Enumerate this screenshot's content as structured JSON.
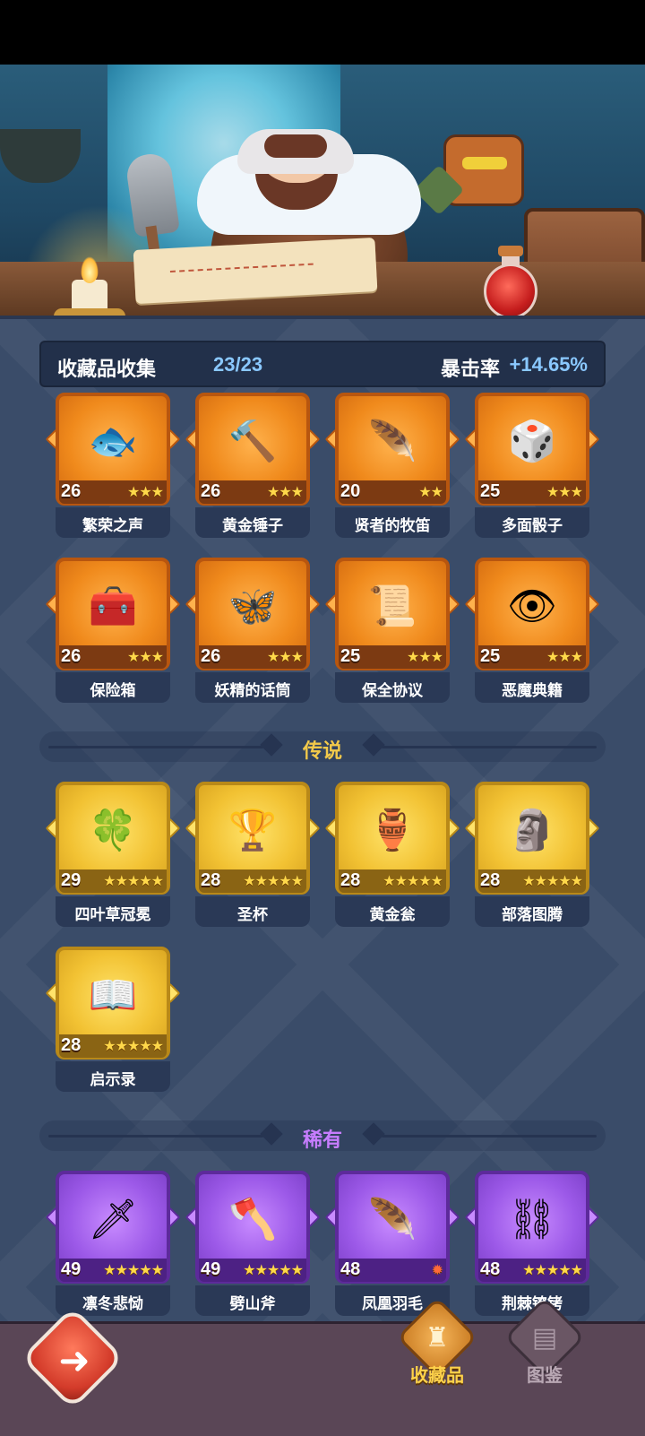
{
  "collection": {
    "label": "收藏品收集",
    "count": "23/23",
    "crit_label": "暴击率",
    "crit_value": "+14.65%"
  },
  "sections": {
    "legend": "传说",
    "rare": "稀有"
  },
  "epic_items": [
    {
      "name": "繁荣之声",
      "level": "26",
      "stars": "★★★",
      "icon": "🐟"
    },
    {
      "name": "黄金锤子",
      "level": "26",
      "stars": "★★★",
      "icon": "🔨"
    },
    {
      "name": "贤者的牧笛",
      "level": "20",
      "stars": "★★",
      "icon": "🪶"
    },
    {
      "name": "多面骰子",
      "level": "25",
      "stars": "★★★",
      "icon": "🎲"
    },
    {
      "name": "保险箱",
      "level": "26",
      "stars": "★★★",
      "icon": "🧰"
    },
    {
      "name": "妖精的话筒",
      "level": "26",
      "stars": "★★★",
      "icon": "🦋"
    },
    {
      "name": "保全协议",
      "level": "25",
      "stars": "★★★",
      "icon": "📜"
    },
    {
      "name": "恶魔典籍",
      "level": "25",
      "stars": "★★★",
      "icon": "👁"
    }
  ],
  "legend_items": [
    {
      "name": "四叶草冠冕",
      "level": "29",
      "stars": "★★★★★",
      "icon": "🍀"
    },
    {
      "name": "圣杯",
      "level": "28",
      "stars": "★★★★★",
      "icon": "🏆"
    },
    {
      "name": "黄金瓮",
      "level": "28",
      "stars": "★★★★★",
      "icon": "🏺"
    },
    {
      "name": "部落图腾",
      "level": "28",
      "stars": "★★★★★",
      "icon": "🗿"
    },
    {
      "name": "启示录",
      "level": "28",
      "stars": "★★★★★",
      "icon": "📖"
    }
  ],
  "rare_items": [
    {
      "name": "凛冬悲恸",
      "level": "49",
      "stars": "★★★★★",
      "icon": "🗡"
    },
    {
      "name": "劈山斧",
      "level": "49",
      "stars": "★★★★★",
      "icon": "🪓"
    },
    {
      "name": "凤凰羽毛",
      "level": "48",
      "stars": "✹",
      "icon": "🪶"
    },
    {
      "name": "荆棘镣铐",
      "level": "48",
      "stars": "★★★★★",
      "icon": "⛓"
    }
  ],
  "nav": {
    "back_icon": "back-arrow-icon",
    "tab_collection": "收藏品",
    "tab_codex": "图鉴"
  },
  "colors": {
    "background": "#3a4c69",
    "epic": "#f08a1c",
    "legend": "#f2c233",
    "rare": "#9c59e8",
    "accent_blue": "#8ac8ff"
  }
}
